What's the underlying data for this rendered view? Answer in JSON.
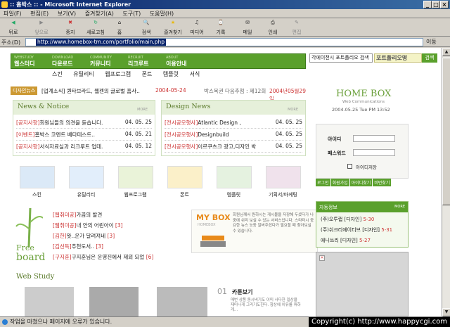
{
  "window": {
    "title": ":: 홈박스 :: - Microsoft Internet Explorer",
    "min": "_",
    "max": "□",
    "close": "×"
  },
  "menu": [
    "파일(F)",
    "편집(E)",
    "보기(V)",
    "즐겨찾기(A)",
    "도구(T)",
    "도움말(H)"
  ],
  "toolbar": {
    "back": "뒤로",
    "forward": "앞으로",
    "stop": "중지",
    "refresh": "새로고침",
    "home": "홈",
    "search": "검색",
    "favorites": "즐겨찾기",
    "media": "미디어",
    "history": "기록",
    "mail": "메일",
    "print": "인쇄",
    "edit": "편집"
  },
  "address": {
    "label": "주소(D)",
    "url": "http://www.homebox-tm.com/portfolio/main.php",
    "go": "이동"
  },
  "site": {
    "gnb": [
      {
        "en": "WEBSTUDY",
        "ko": "웹스터디"
      },
      {
        "en": "DOWNLOAD",
        "ko": "다운로드"
      },
      {
        "en": "COMMUNITY",
        "ko": "커뮤니티"
      },
      {
        "en": "RECRUIT",
        "ko": "리크루트"
      },
      {
        "en": "ABOUT",
        "ko": "이용안내"
      }
    ],
    "search_select": "각에이전시 포트폴리오 검색",
    "search_value": "포트폴리오명",
    "search_button": "검색",
    "submenu": [
      "스킨",
      "유틸리티",
      "웹프로그램",
      "폰트",
      "템플릿",
      "서식"
    ],
    "hot": {
      "tag": "디자인뉴스",
      "text": "[업계소식] 퀀타브라드, 웹젠의 글로벌 홈사..",
      "date": "2004-05-24",
      "event_prefix": "박스복권 다음추첨 : 제12회",
      "event_date": "2004년05월29일"
    },
    "news": {
      "title": "News & Notice",
      "more": "MORE",
      "items": [
        {
          "cat": "[공지사항]",
          "text": "회원님들의 의견을 듣습니다.",
          "date": "04. 05. 25"
        },
        {
          "cat": "[이벤트]",
          "text": "홈박스 코멘트 베타테스트..",
          "date": "04. 05. 21"
        },
        {
          "cat": "[공지사항]",
          "text": "서식자료실과 리크루트 업데.",
          "date": "04. 05. 12"
        }
      ]
    },
    "design": {
      "title": "Design News",
      "more": "MORE",
      "items": [
        {
          "cat": "[전시공모행사]",
          "text": "Atlantic Design ,",
          "date": "04. 05. 25"
        },
        {
          "cat": "[전시공모행사]",
          "text": "Designbuild",
          "date": "04. 05. 25"
        },
        {
          "cat": "[전시공모행사]",
          "text": "이르쿠츠크 광고,디자인 박",
          "date": "04. 05. 25"
        }
      ]
    },
    "icons": [
      "스킨",
      "유틸리티",
      "웹프로그램",
      "폰트",
      "템플릿",
      "기획서/마케팅"
    ],
    "board": {
      "logo_top": "Free",
      "logo_bottom": "board",
      "items": [
        {
          "cat": "[웹취미공]",
          "text": "가끔의 발견",
          "count": ""
        },
        {
          "cat": "[웹취미공]",
          "text": "내 안의 어린아이",
          "count": "[3]"
        },
        {
          "cat": "[김한]",
          "text": "왓..운가 달려져네",
          "count": "[3]"
        },
        {
          "cat": "[김선득]",
          "text": "추천도서..",
          "count": "[3]"
        },
        {
          "cat": "[구지훈]",
          "text": "구지훈님은 운영진에서 제외 되었",
          "count": "[6]"
        }
      ]
    },
    "mybox": {
      "title": "MY BOX",
      "sub": "HOMEBOX",
      "desc": "회원님께서 원하시는 게시물을 저장해 두셨다가 나중에 쉬리 보실 수 있는 서비스입니다. 스타터시 중요한 뉴스 능동 알버주셨다가 필요할 때 찾아보실 수 있습니다."
    },
    "study": {
      "title": "Web Study",
      "num": "01",
      "label": "카툰보기",
      "desc": "매번 상품 동시비기도 이미 사다한 일상을 재미나게 그리기도한다. 항상에 이유를 뭐하게..."
    },
    "brand": {
      "name": "HOME BOX",
      "sub": "Web Communications",
      "date": "2004.05.25 Tue PM 13:52"
    },
    "login": {
      "id_label": "아이디",
      "pw_label": "패스워드",
      "save": "아이디저장",
      "buttons": [
        "로그인",
        "회원가입",
        "아이디찾기",
        "비번찾기"
      ]
    },
    "agency": {
      "title": "자동정보",
      "more": "MORE",
      "items": [
        {
          "text": "(주)오투랩 [디자인]",
          "count": "5-30"
        },
        {
          "text": "(주)쉬크리에이티브 [디자인]",
          "count": "5-31"
        },
        {
          "text": "에니쓰리 [디자인]",
          "count": "5-27"
        }
      ]
    }
  },
  "status": {
    "text": "작업을 마쳤으나 페이지에 오류가 있습니다.",
    "copyright": "Copyright(c) http://www.happycgi.com"
  },
  "colors": {
    "brand_green": "#5aa02c",
    "title_blue": "#0a246a",
    "accent_red": "#cc3333"
  }
}
